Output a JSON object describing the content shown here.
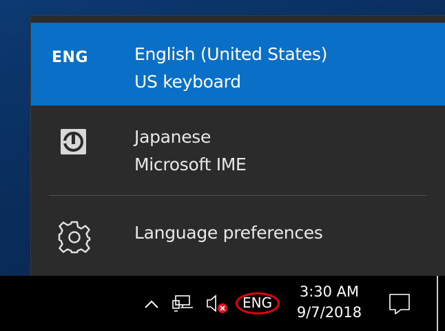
{
  "language_flyout": {
    "languages": [
      {
        "icon_text": "ENG",
        "name": "English (United States)",
        "layout": "US keyboard",
        "selected": true
      },
      {
        "icon": "ime-icon",
        "name": "Japanese",
        "layout": "Microsoft IME",
        "selected": false
      }
    ],
    "preferences_label": "Language preferences",
    "preferences_icon": "gear-icon"
  },
  "taskbar": {
    "tray_icons": [
      "chevron-up-icon",
      "network-icon",
      "volume-muted-icon"
    ],
    "input_indicator": "ENG",
    "time": "3:30 AM",
    "date": "9/7/2018",
    "notification_icon": "action-center-icon"
  },
  "colors": {
    "accent": "#0a6fc7",
    "flyout_bg": "#2b2b2b",
    "taskbar_bg": "#000000",
    "highlight_circle": "#e3000f",
    "muted_badge": "#e81123"
  }
}
